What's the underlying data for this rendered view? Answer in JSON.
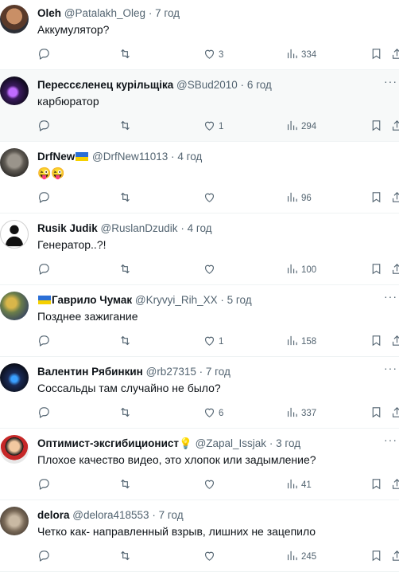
{
  "replies": [
    {
      "name": "Oleh",
      "handle": "@Patalakh_Oleg",
      "sep": "·",
      "time": "7 год",
      "text": "Аккумулятор?",
      "likes": "3",
      "views": "334",
      "highlight": false
    },
    {
      "name": "Перессєленец курільщіка",
      "handle": "@SBud2010",
      "sep": "·",
      "time": "6 год",
      "text": "карбюратор",
      "likes": "1",
      "views": "294",
      "highlight": true
    },
    {
      "name": "DrfNew",
      "handle": "@DrfNew11013",
      "sep": "·",
      "time": "4 год",
      "text": "😜😜",
      "likes": "",
      "views": "96",
      "highlight": false,
      "name_flag_after": true
    },
    {
      "name": "Rusik Judik",
      "handle": "@RuslanDzudik",
      "sep": "·",
      "time": "4 год",
      "text": "Генератор..?!",
      "likes": "",
      "views": "100",
      "highlight": false
    },
    {
      "name": "Гаврило Чумак",
      "handle": "@Kryvyi_Rih_XX",
      "sep": "·",
      "time": "5 год",
      "text": "Позднее зажигание",
      "likes": "1",
      "views": "158",
      "highlight": false,
      "name_flag_before": true
    },
    {
      "name": "Валентин Рябинкин",
      "handle": "@rb27315",
      "sep": "·",
      "time": "7 год",
      "text": "Соссальды там случайно не было?",
      "likes": "6",
      "views": "337",
      "highlight": false
    },
    {
      "name": "Оптимист-эксгибиционист💡",
      "handle": "@Zapal_Issjak",
      "sep": "·",
      "time": "3 год",
      "text": "Плохое качество видео, это хлопок или задымление?",
      "likes": "",
      "views": "41",
      "highlight": false
    },
    {
      "name": "delora",
      "handle": "@delora418553",
      "sep": "·",
      "time": "7 год",
      "text": "Четко как- направленный взрыв, лишних не зацепило",
      "likes": "",
      "views": "245",
      "highlight": false
    }
  ],
  "icons": {
    "reply": "reply-icon",
    "retweet": "retweet-icon",
    "like": "heart-icon",
    "views": "views-icon",
    "bookmark": "bookmark-icon",
    "share": "share-icon",
    "more": "more-icon"
  },
  "more_glyph": "···",
  "colors": {
    "muted": "#536471",
    "text": "#0f1419",
    "highlight_bg": "#f7f9f9",
    "divider": "#eff3f4"
  }
}
